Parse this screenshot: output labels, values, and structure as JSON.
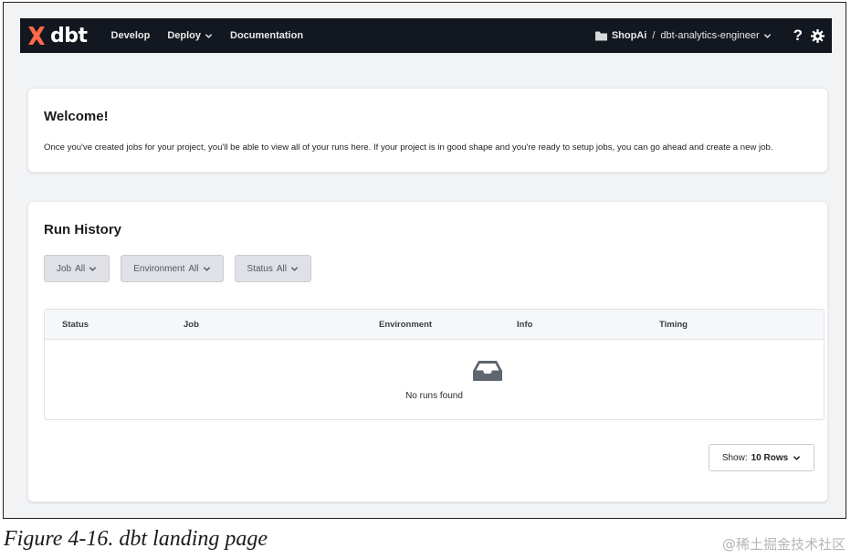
{
  "navbar": {
    "logo_text": "dbt",
    "brand_color": "#ff694a",
    "links": [
      {
        "label": "Develop",
        "has_dropdown": false
      },
      {
        "label": "Deploy",
        "has_dropdown": true
      },
      {
        "label": "Documentation",
        "has_dropdown": false
      }
    ],
    "project_name": "ShopAi",
    "separator": "/",
    "user_name": "dbt-analytics-engineer",
    "help_label": "?"
  },
  "welcome": {
    "title": "Welcome!",
    "body": "Once you've created jobs for your project, you'll be able to view all of your runs here. If your project is in good shape and you're ready to setup jobs, you can go ahead and create a new job."
  },
  "run_history": {
    "title": "Run History",
    "filters": [
      {
        "label": "Job",
        "value": "All"
      },
      {
        "label": "Environment",
        "value": "All"
      },
      {
        "label": "Status",
        "value": "All"
      }
    ],
    "columns": [
      "Status",
      "Job",
      "Environment",
      "Info",
      "Timing"
    ],
    "empty_text": "No runs found",
    "rows_select": {
      "label": "Show:",
      "value": "10 Rows"
    }
  },
  "caption": "Figure 4-16. dbt landing page",
  "watermark": "@稀土掘金技术社区"
}
